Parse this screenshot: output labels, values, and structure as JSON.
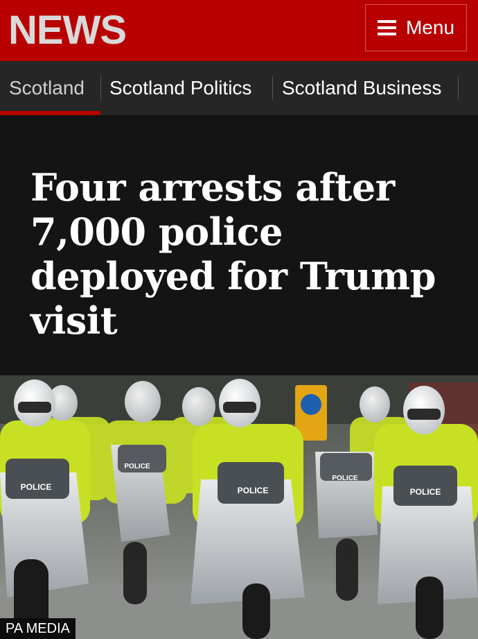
{
  "header": {
    "logo": "NEWS",
    "menu_label": "Menu"
  },
  "nav": {
    "items": [
      {
        "label": "Scotland",
        "active": true
      },
      {
        "label": "Scotland Politics",
        "active": false
      },
      {
        "label": "Scotland Business",
        "active": false
      }
    ]
  },
  "article": {
    "headline": "Four arrests after 7,000 police deployed for Trump visit"
  },
  "image": {
    "caption": "PA MEDIA",
    "sign_text": "POLICE"
  },
  "colors": {
    "brand_red": "#b80000",
    "nav_bg": "#262626",
    "page_bg": "#141414",
    "hi_vis": "#c8e024"
  }
}
